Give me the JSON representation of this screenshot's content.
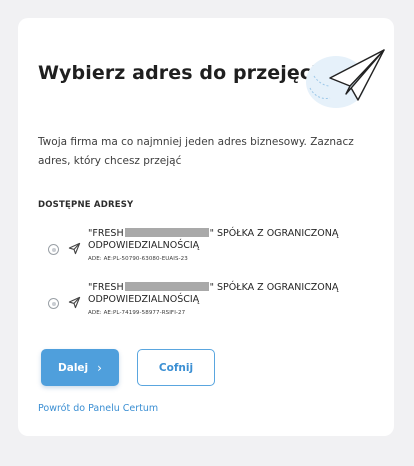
{
  "card": {
    "title": "Wybierz adres do przejęcia",
    "intro": "Twoja firma ma co najmniej jeden adres biznesowy. Zaznacz adres, który chcesz przejąć",
    "section_title": "DOSTĘPNE ADRESY",
    "illustration_icon": "paper-plane-icon"
  },
  "addresses": [
    {
      "name_prefix": "\"FRESH",
      "name_suffix": "\" SPÓŁKA Z OGRANICZONĄ",
      "name_line2": "ODPOWIEDZIALNOŚCIĄ",
      "ade": "ADE: AE:PL-50790-63080-EUAIS-23",
      "selected": false
    },
    {
      "name_prefix": "\"FRESH",
      "name_suffix": "\" SPÓŁKA Z OGRANICZONĄ",
      "name_line2": "ODPOWIEDZIALNOŚCIĄ",
      "ade": "ADE: AE:PL-74199-58977-RSIFI-27",
      "selected": false
    }
  ],
  "buttons": {
    "next_label": "Dalej",
    "next_icon": "chevron-right-icon",
    "back_label": "Cofnij"
  },
  "links": {
    "panel_label": "Powrót do Panelu Certum"
  },
  "colors": {
    "primary": "#4f9fdc",
    "link": "#3b8fd3",
    "background": "#f1f1f3"
  }
}
